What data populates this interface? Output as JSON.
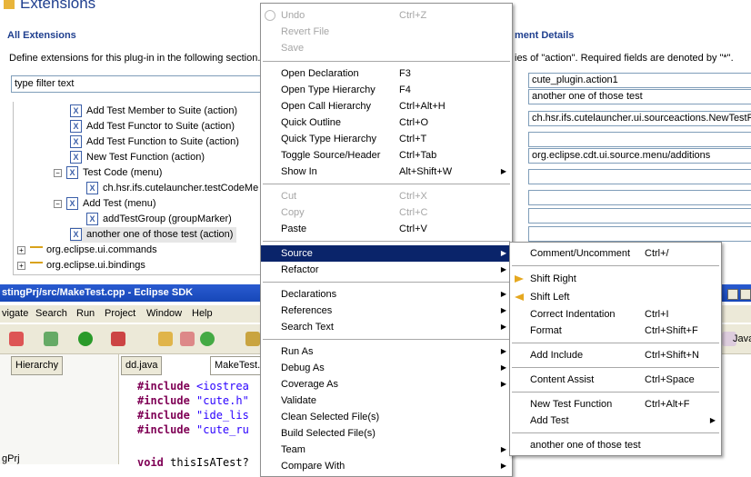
{
  "extensions_editor": {
    "title": "Extensions",
    "all_extensions_title": "All Extensions",
    "description": "Define extensions for this plug-in in the following section.",
    "filter_placeholder": "type filter text",
    "tree_items": [
      "Add Test Member to Suite (action)",
      "Add Test Functor to Suite (action)",
      "Add Test Function to Suite (action)",
      "New Test Function (action)",
      "Test Code (menu)",
      "ch.hsr.ifs.cutelauncher.testCodeMe",
      "Add Test (menu)",
      "addTestGroup (groupMarker)",
      "another one of those test (action)",
      "org.eclipse.ui.commands",
      "org.eclipse.ui.bindings"
    ],
    "details_title": "ment Details",
    "details_description": "ies of \"action\". Required fields are denoted by \"*\".",
    "details_fields": [
      "cute_plugin.action1",
      "another one of those test",
      "",
      "ch.hsr.ifs.cutelauncher.ui.sourceactions.NewTestF",
      "",
      "org.eclipse.cdt.ui.source.menu/additions",
      "",
      "",
      "",
      "",
      ""
    ]
  },
  "workbench": {
    "title": "stingPrj/src/MakeTest.cpp - Eclipse SDK",
    "menu": [
      "vigate",
      "Search",
      "Run",
      "Project",
      "Window",
      "Help"
    ],
    "view_tab": "Hierarchy",
    "editor_tabs": [
      "dd.java",
      "MakeTest."
    ],
    "right_tab": "Java",
    "project_label": "gPrj",
    "code_lines": [
      {
        "kw": "#include",
        "str": "<iostrea"
      },
      {
        "kw": "#include",
        "str": "\"cute.h\""
      },
      {
        "kw": "#include",
        "str": "\"ide_lis"
      },
      {
        "kw": "#include",
        "str": "\"cute_ru"
      },
      {
        "kw": "void",
        "str": "thisIsATest?"
      }
    ]
  },
  "context_menu": {
    "items": [
      {
        "label": "Undo",
        "accel": "Ctrl+Z",
        "disabled": true,
        "icon": "undo-icon"
      },
      {
        "label": "Revert File",
        "accel": "",
        "disabled": true
      },
      {
        "label": "Save",
        "accel": "",
        "disabled": true
      },
      {
        "label": "Open Declaration",
        "accel": "F3"
      },
      {
        "label": "Open Type Hierarchy",
        "accel": "F4"
      },
      {
        "label": "Open Call Hierarchy",
        "accel": "Ctrl+Alt+H"
      },
      {
        "label": "Quick Outline",
        "accel": "Ctrl+O"
      },
      {
        "label": "Quick Type Hierarchy",
        "accel": "Ctrl+T"
      },
      {
        "label": "Toggle Source/Header",
        "accel": "Ctrl+Tab"
      },
      {
        "label": "Show In",
        "accel": "Alt+Shift+W",
        "submenu": true
      },
      {
        "label": "Cut",
        "accel": "Ctrl+X",
        "disabled": true
      },
      {
        "label": "Copy",
        "accel": "Ctrl+C",
        "disabled": true
      },
      {
        "label": "Paste",
        "accel": "Ctrl+V"
      },
      {
        "label": "Source",
        "accel": "",
        "submenu": true,
        "highlighted": true
      },
      {
        "label": "Refactor",
        "accel": "",
        "submenu": true
      },
      {
        "label": "Declarations",
        "accel": "",
        "submenu": true
      },
      {
        "label": "References",
        "accel": "",
        "submenu": true
      },
      {
        "label": "Search Text",
        "accel": "",
        "submenu": true
      },
      {
        "label": "Run As",
        "accel": "",
        "submenu": true
      },
      {
        "label": "Debug As",
        "accel": "",
        "submenu": true
      },
      {
        "label": "Coverage As",
        "accel": "",
        "submenu": true
      },
      {
        "label": "Validate",
        "accel": ""
      },
      {
        "label": "Clean Selected File(s)",
        "accel": ""
      },
      {
        "label": "Build Selected File(s)",
        "accel": ""
      },
      {
        "label": "Team",
        "accel": "",
        "submenu": true
      },
      {
        "label": "Compare With",
        "accel": "",
        "submenu": true
      }
    ]
  },
  "source_submenu": {
    "items": [
      {
        "label": "Comment/Uncomment",
        "accel": "Ctrl+/"
      },
      {
        "label": "Shift Right",
        "accel": "",
        "icon": "shift-right-icon"
      },
      {
        "label": "Shift Left",
        "accel": "",
        "icon": "shift-left-icon"
      },
      {
        "label": "Correct Indentation",
        "accel": "Ctrl+I"
      },
      {
        "label": "Format",
        "accel": "Ctrl+Shift+F"
      },
      {
        "label": "Add Include",
        "accel": "Ctrl+Shift+N"
      },
      {
        "label": "Content Assist",
        "accel": "Ctrl+Space"
      },
      {
        "label": "New Test Function",
        "accel": "Ctrl+Alt+F"
      },
      {
        "label": "Add Test",
        "accel": "",
        "submenu": true
      },
      {
        "label": "another one of those test",
        "accel": ""
      }
    ]
  },
  "colors": {
    "menu_highlight": "#0a246a",
    "section_title": "#1f3f8f",
    "title_bar": "#1f4fc3"
  }
}
